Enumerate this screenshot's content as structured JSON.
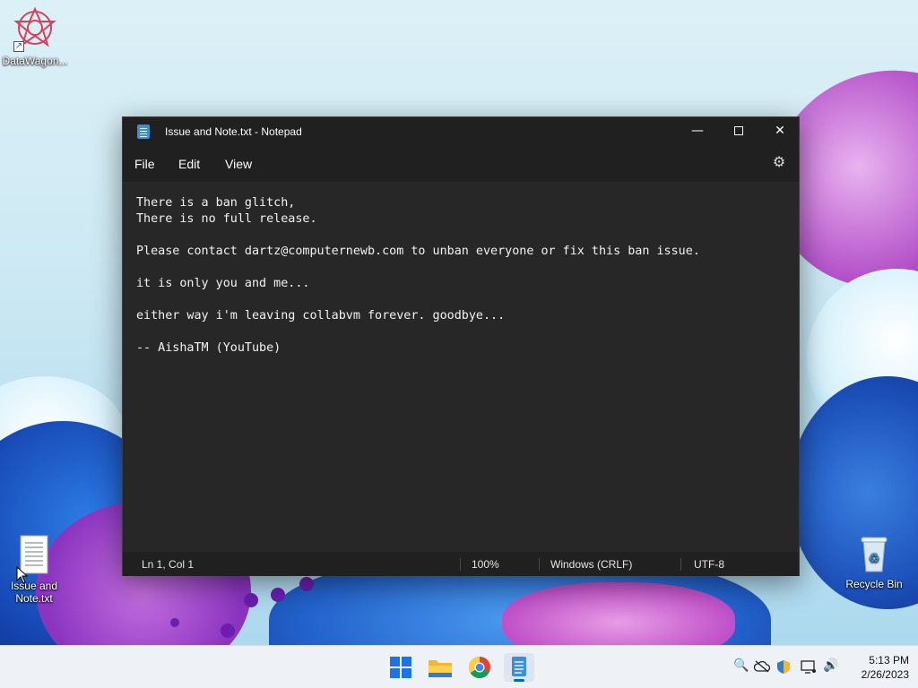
{
  "desktop": {
    "icons": [
      {
        "label": "DataWagon..."
      },
      {
        "label": "Issue and Note.txt"
      },
      {
        "label": "Recycle Bin"
      }
    ]
  },
  "window": {
    "title": "Issue and Note.txt - Notepad",
    "controls": {
      "minimize": "—",
      "maximize": "",
      "close": "✕"
    },
    "menu": {
      "file": "File",
      "edit": "Edit",
      "view": "View"
    },
    "settings_icon": "gear-icon",
    "content_lines": [
      "There is a ban glitch,",
      "There is no full release.",
      "",
      "Please contact dartz@computernewb.com to unban everyone or fix this ban issue.",
      "",
      "it is only you and me...",
      "",
      "either way i'm leaving collabvm forever. goodbye...",
      "",
      "-- AishaTM (YouTube)"
    ],
    "status": {
      "position": "Ln 1, Col 1",
      "zoom": "100%",
      "line_ending": "Windows (CRLF)",
      "encoding": "UTF-8"
    }
  },
  "taskbar": {
    "apps": [
      {
        "name": "start",
        "icon": "windows-logo-icon"
      },
      {
        "name": "file-explorer",
        "icon": "folder-icon"
      },
      {
        "name": "chrome",
        "icon": "chrome-icon"
      },
      {
        "name": "notepad",
        "icon": "notepad-icon"
      }
    ],
    "tray_icons": [
      "search-tool-icon",
      "cloud-offline-icon",
      "security-shield-icon",
      "network-icon",
      "volume-icon"
    ],
    "time": "5:13 PM",
    "date": "2/26/2023"
  },
  "colors": {
    "window_bg": "#272727",
    "titlebar_bg": "#202020",
    "taskbar_bg": "#eef2f7",
    "accent": "#0067c0"
  }
}
